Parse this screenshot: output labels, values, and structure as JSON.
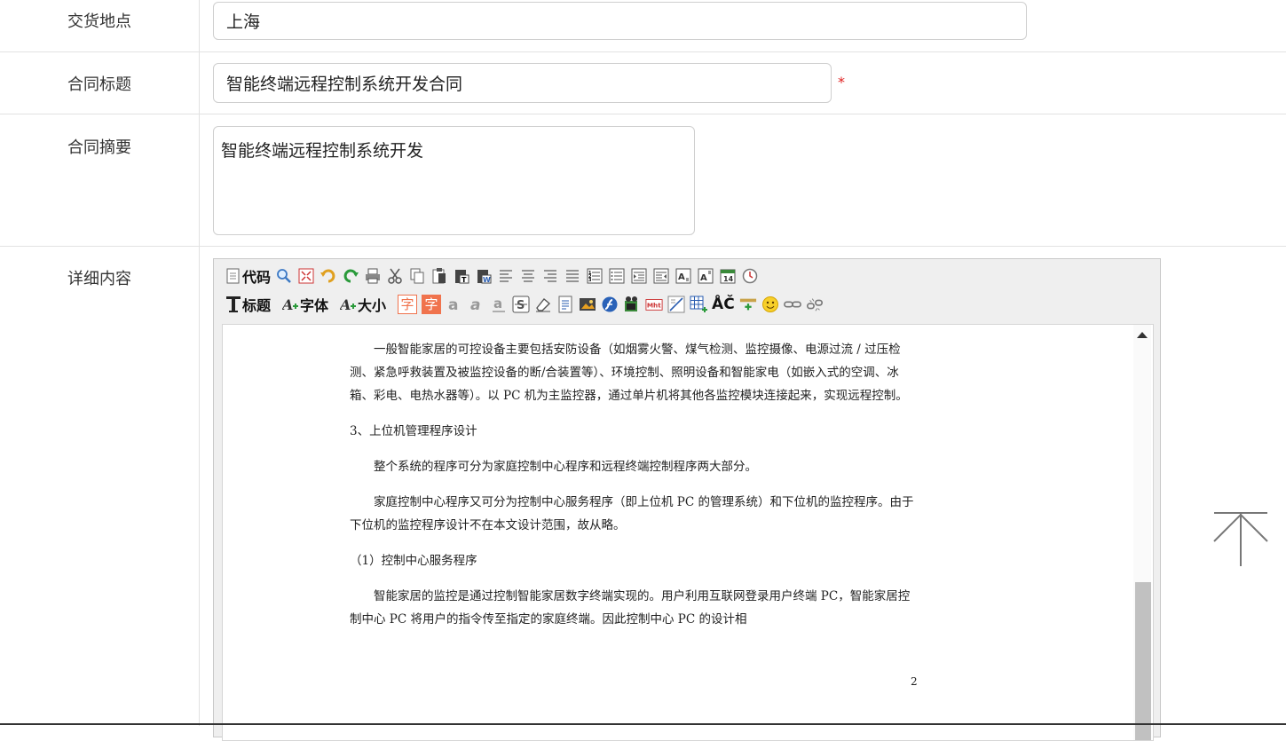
{
  "form": {
    "delivery_place": {
      "label": "交货地点",
      "value": "上海"
    },
    "contract_title": {
      "label": "合同标题",
      "value": "智能终端远程控制系统开发合同",
      "required_mark": "*"
    },
    "contract_summary": {
      "label": "合同摘要",
      "value": "智能终端远程控制系统开发"
    },
    "detail_content": {
      "label": "详细内容"
    }
  },
  "editor": {
    "toolbar_row1": {
      "code_label": "代码"
    },
    "toolbar_row2": {
      "title_label": "标题",
      "font_label": "字体",
      "size_label": "大小",
      "char_label": "字",
      "char_label2": "字",
      "spell_label": "ÅČ"
    },
    "document": {
      "p1": "一般智能家居的可控设备主要包括安防设备（如烟雾火警、煤气检测、监控摄像、电源过流 / 过压检测、紧急呼救装置及被监控设备的断/合装置等）、环境控制、照明设备和智能家电（如嵌入式的空调、冰箱、彩电、电热水器等）。以 PC 机为主监控器，通过单片机将其他各监控模块连接起来，实现远程控制。",
      "h1": "3、上位机管理程序设计",
      "p2": "整个系统的程序可分为家庭控制中心程序和远程终端控制程序两大部分。",
      "p3": "家庭控制中心程序又可分为控制中心服务程序（即上位机 PC 的管理系统）和下位机的监控程序。由于下位机的监控程序设计不在本文设计范围，故从略。",
      "h2": "（1）控制中心服务程序",
      "p4": "智能家居的监控是通过控制智能家居数字终端实现的。用户利用互联网登录用户终端 PC，智能家居控制中心 PC 将用户的指令传至指定的家庭终端。因此控制中心 PC 的设计相",
      "page_number": "2"
    }
  },
  "icons": {
    "row1": [
      "source-icon",
      "search-icon",
      "fullscreen-icon",
      "undo-icon",
      "redo-icon",
      "print-icon",
      "cut-icon",
      "copy-icon",
      "paste-icon",
      "paste-text-icon",
      "paste-word-icon",
      "align-left-icon",
      "align-center-icon",
      "align-right-icon",
      "justify-icon",
      "ordered-list-icon",
      "unordered-list-icon",
      "indent-icon",
      "outdent-icon",
      "subscript-icon",
      "superscript-icon",
      "date-icon",
      "time-icon"
    ],
    "row2": [
      "heading-icon",
      "font-family-icon",
      "font-size-icon",
      "font-color-icon",
      "background-color-icon",
      "bold-icon",
      "italic-icon",
      "underline-icon",
      "strikethrough-icon",
      "remove-format-icon",
      "select-all-icon",
      "image-icon",
      "flash-icon",
      "media-icon",
      "mht-icon",
      "horizontal-rule-icon",
      "table-icon",
      "special-char-icon",
      "page-break-icon",
      "emoticon-icon",
      "link-icon",
      "unlink-icon"
    ]
  },
  "colors": {
    "border": "#e2e2e2",
    "required": "#e02020",
    "char_highlight": "#f0734d"
  }
}
